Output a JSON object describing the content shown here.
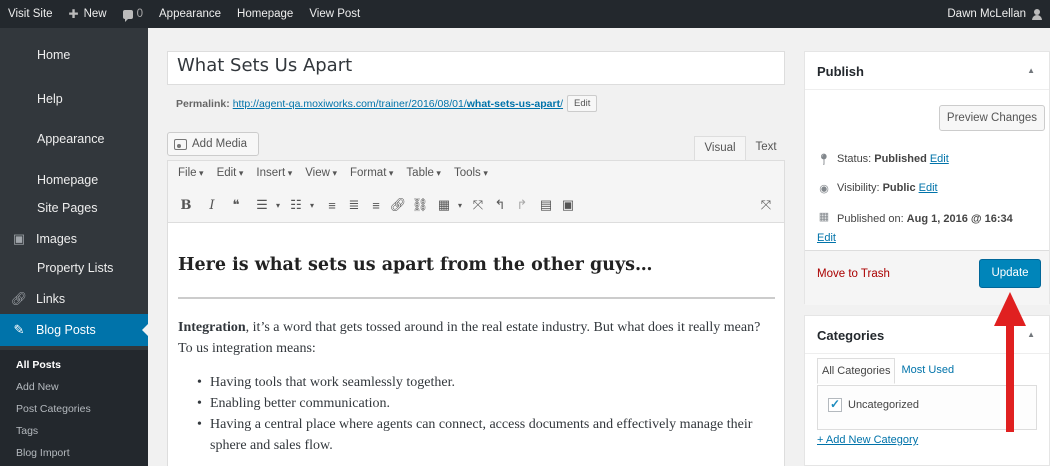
{
  "adminbar": {
    "visit_site": "Visit Site",
    "new": "New",
    "comments_count": "0",
    "appearance": "Appearance",
    "homepage": "Homepage",
    "view_post": "View Post",
    "user": "Dawn McLellan"
  },
  "sidebar": {
    "home": "Home",
    "help": "Help",
    "appearance": "Appearance",
    "homepage": "Homepage",
    "site_pages": "Site Pages",
    "images": "Images",
    "property_lists": "Property Lists",
    "links": "Links",
    "blog_posts": "Blog Posts",
    "submenu": {
      "all_posts": "All Posts",
      "add_new": "Add New",
      "post_categories": "Post Categories",
      "tags": "Tags",
      "blog_import": "Blog Import"
    }
  },
  "editor": {
    "title": "What Sets Us Apart",
    "permalink_label": "Permalink:",
    "permalink_base": "http://agent-qa.moxiworks.com/trainer/2016/08/01/",
    "permalink_slug": "what-sets-us-apart",
    "permalink_trailing": "/",
    "edit_label": "Edit",
    "add_media": "Add Media",
    "tab_visual": "Visual",
    "tab_text": "Text",
    "menus": [
      "File",
      "Edit",
      "Insert",
      "View",
      "Format",
      "Table",
      "Tools"
    ]
  },
  "content": {
    "heading": "Here is what sets us apart from the other guys…",
    "para_bold": "Integration",
    "para_rest": ", it’s a word that gets tossed around in the real estate industry. But what does it really mean? To us integration means:",
    "bullets": [
      "Having tools that work seamlessly together.",
      "Enabling better communication.",
      "Having a central place where agents can connect, access documents and effectively manage their sphere and sales flow."
    ]
  },
  "publish": {
    "title": "Publish",
    "preview": "Preview Changes",
    "status_label": "Status:",
    "status_value": "Published",
    "visibility_label": "Visibility:",
    "visibility_value": "Public",
    "published_label": "Published on:",
    "published_value": "Aug 1, 2016 @ 16:34",
    "edit": "Edit",
    "trash": "Move to Trash",
    "update": "Update"
  },
  "categories": {
    "title": "Categories",
    "tab_all": "All Categories",
    "tab_most_used": "Most Used",
    "items": [
      "Uncategorized"
    ],
    "add_new": "+ Add New Category"
  },
  "colors": {
    "adminbar": "#23282d",
    "sidebar": "#32373c",
    "active": "#0073aa",
    "update_button": "#0085ba",
    "annotation_arrow": "#e02020"
  }
}
